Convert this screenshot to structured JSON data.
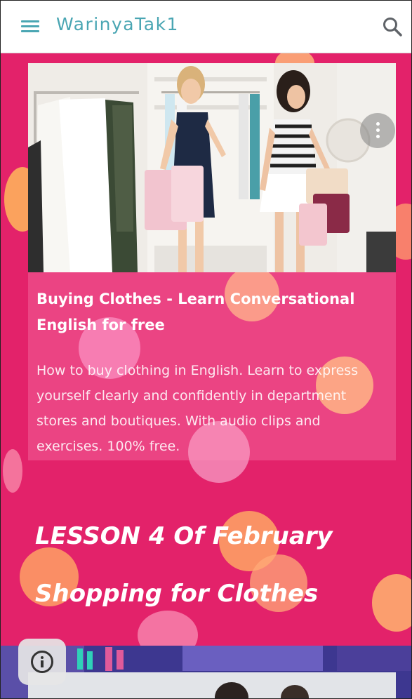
{
  "header": {
    "site_title": "WarinyaTak1",
    "menu_icon": "hamburger-menu-icon",
    "search_icon": "search-icon"
  },
  "card": {
    "title": "Buying Clothes - Learn Conversational English for free",
    "description": "How to buy clothing in English. Learn to express yourself clearly and confidently in department stores and boutiques. With audio clips and exercises. 100% free.",
    "more_icon": "more-vertical-icon"
  },
  "lesson": {
    "line1": "LESSON 4 Of February",
    "line2": "Shopping for Clothes"
  },
  "info_button": {
    "icon": "info-icon"
  },
  "colors": {
    "accent": "#4aa6b3",
    "background": "#e3226a",
    "bottom_strip": "#3b3590"
  }
}
